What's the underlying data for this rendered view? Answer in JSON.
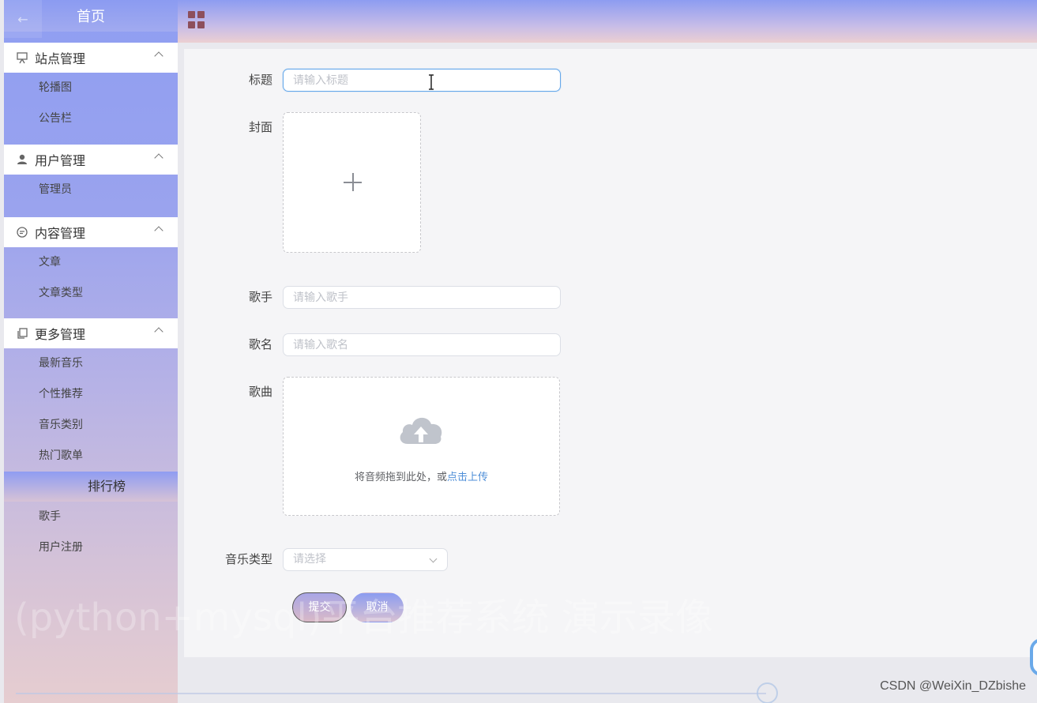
{
  "sidebar": {
    "back_icon": "arrow-left-icon",
    "home_label": "首页",
    "groups": [
      {
        "title": "站点管理",
        "icon": "easel-icon",
        "items": [
          "轮播图",
          "公告栏"
        ]
      },
      {
        "title": "用户管理",
        "icon": "user-icon",
        "items": [
          "管理员"
        ]
      },
      {
        "title": "内容管理",
        "icon": "chat-icon",
        "items": [
          "文章",
          "文章类型"
        ]
      },
      {
        "title": "更多管理",
        "icon": "copy-icon",
        "items": [
          "最新音乐",
          "个性推荐",
          "音乐类别",
          "热门歌单"
        ]
      }
    ],
    "rank": {
      "title": "排行榜",
      "items": [
        "歌手",
        "用户注册"
      ]
    }
  },
  "header": {
    "menu_icon": "grid-icon"
  },
  "form": {
    "title": {
      "label": "标题",
      "placeholder": "请输入标题",
      "value": ""
    },
    "cover": {
      "label": "封面",
      "icon": "plus-icon"
    },
    "singer": {
      "label": "歌手",
      "placeholder": "请输入歌手",
      "value": ""
    },
    "song_name": {
      "label": "歌名",
      "placeholder": "请输入歌名",
      "value": ""
    },
    "song": {
      "label": "歌曲",
      "icon": "cloud-upload-icon",
      "drag_text": "将音频拖到此处，或",
      "link_text": "点击上传"
    },
    "music_type": {
      "label": "音乐类型",
      "placeholder": "请选择"
    },
    "submit_label": "提交",
    "cancel_label": "取消"
  },
  "overlay": {
    "watermark": "(python+mysql)平台推荐系统 演示录像",
    "credit": "CSDN @WeiXin_DZbishe"
  },
  "colors": {
    "accent_blue": "#8d9cf1",
    "accent_pink": "#eccfd2",
    "link": "#4f8fd8",
    "focus_border": "#65a8ea"
  }
}
